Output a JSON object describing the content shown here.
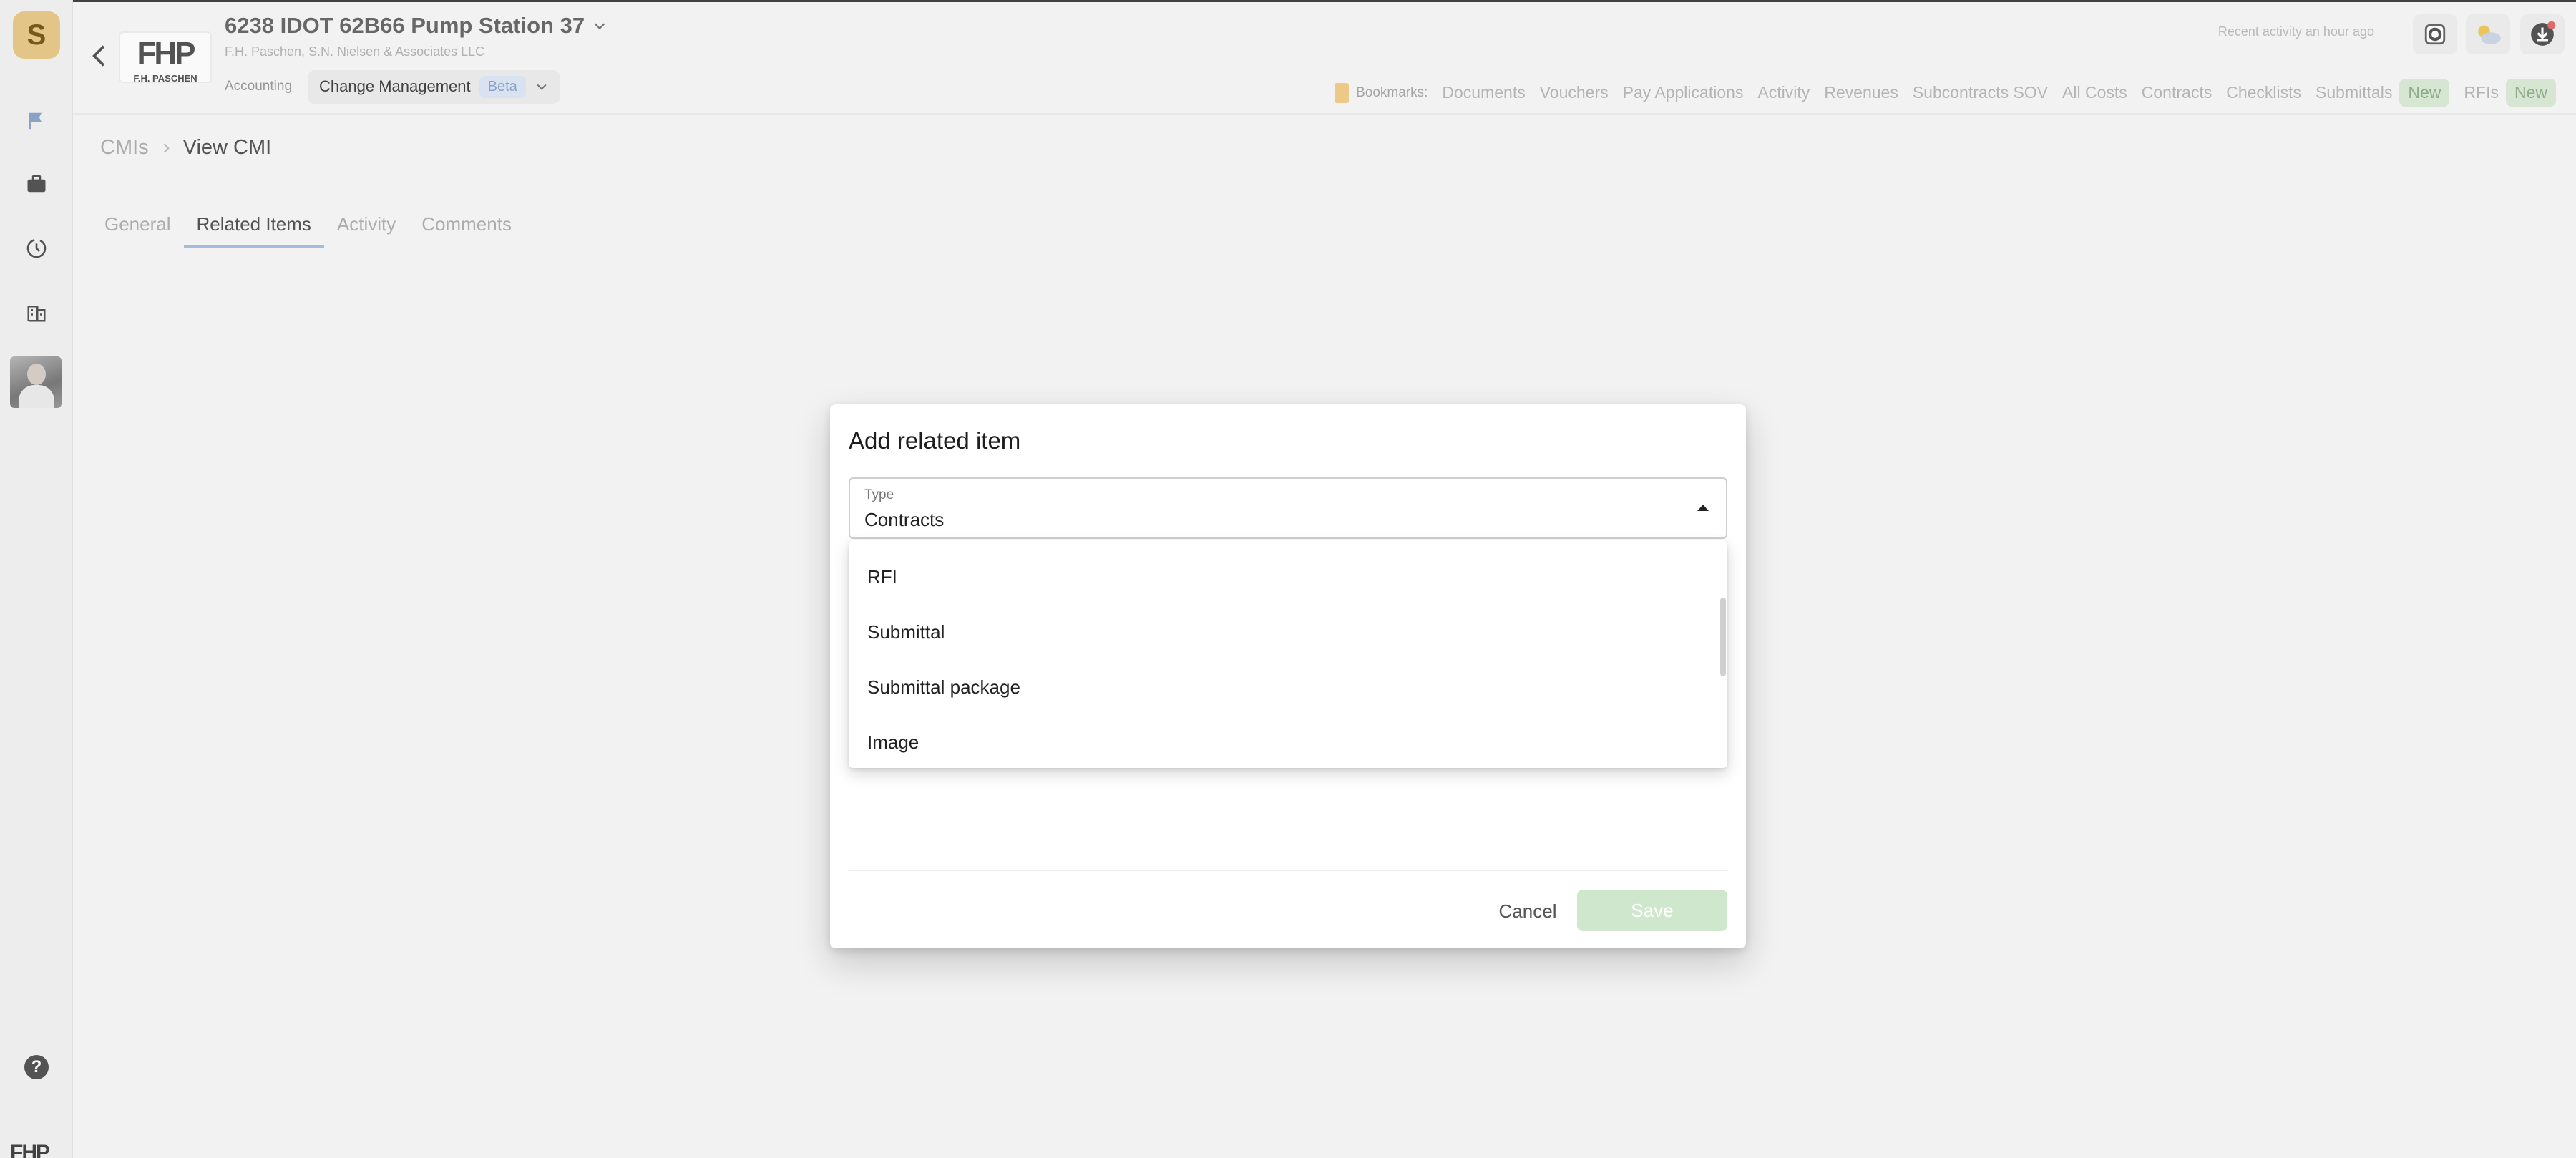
{
  "app": {
    "logo_letter": "S"
  },
  "project": {
    "title": "6238 IDOT 62B66 Pump Station 37",
    "company_line": "F.H. Paschen, S.N. Nielsen & Associates LLC",
    "logo_mark": "FHP",
    "logo_sub": "F.H. PASCHEN"
  },
  "subnav": {
    "accounting": "Accounting",
    "module": "Change Management",
    "badge": "Beta"
  },
  "header": {
    "activity": "Recent activity an hour ago"
  },
  "bookmarks": {
    "label": "Bookmarks:",
    "items": [
      "Documents",
      "Vouchers",
      "Pay Applications",
      "Activity",
      "Revenues",
      "Subcontracts SOV",
      "All Costs",
      "Contracts",
      "Checklists",
      "Submittals",
      "RFIs"
    ],
    "new_badge": "New"
  },
  "breadcrumb": {
    "parent": "CMIs",
    "current": "View CMI"
  },
  "tabs": [
    "General",
    "Related Items",
    "Activity",
    "Comments"
  ],
  "dialog": {
    "title": "Add related item",
    "type_label": "Type",
    "type_value": "Contracts",
    "options": [
      "RFI",
      "Submittal",
      "Submittal package",
      "Image"
    ],
    "cancel": "Cancel",
    "save": "Save"
  },
  "colors": {
    "accent_tab": "#a9c0e0",
    "save_disabled": "#cfe7cc",
    "bookmark_flag": "#f1ce8a",
    "logo_bg": "#e8c98a"
  }
}
